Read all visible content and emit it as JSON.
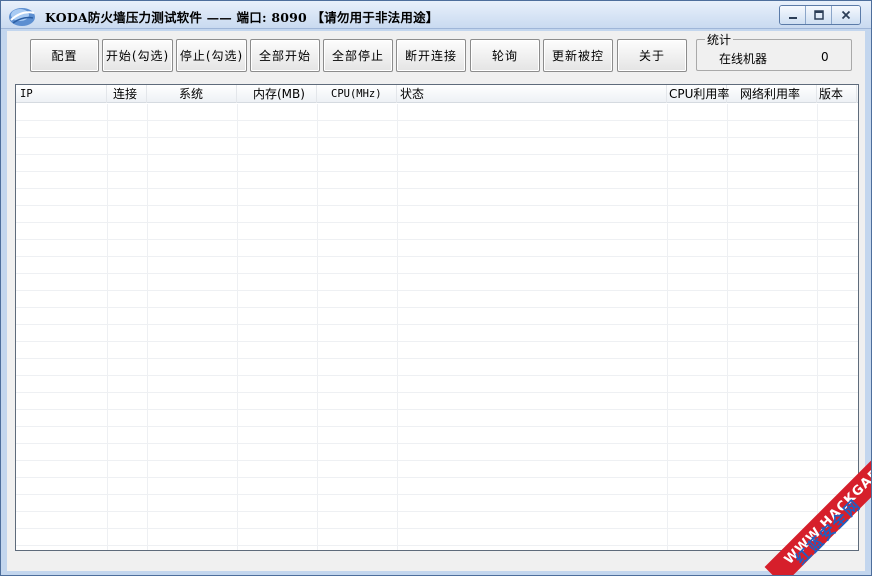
{
  "window": {
    "title": "KODA防火墙压力测试软件 —— 端口: 8090 【请勿用于非法用途】",
    "icon": "app-logo-icon",
    "controls": [
      "minimize-icon",
      "restore-icon",
      "close-icon"
    ]
  },
  "toolbar": {
    "buttons": [
      {
        "id": "config",
        "label": "配置"
      },
      {
        "id": "start_checked",
        "label": "开始(勾选)"
      },
      {
        "id": "stop_checked",
        "label": "停止(勾选)"
      },
      {
        "id": "start_all",
        "label": "全部开始"
      },
      {
        "id": "stop_all",
        "label": "全部停止"
      },
      {
        "id": "disconnect",
        "label": "断开连接"
      },
      {
        "id": "poll",
        "label": "轮询"
      },
      {
        "id": "update",
        "label": "更新被控"
      },
      {
        "id": "about",
        "label": "关于"
      }
    ]
  },
  "stats": {
    "legend": "统计",
    "online_label": "在线机器",
    "online_count": "0"
  },
  "list": {
    "columns": [
      "IP",
      "连接",
      "系统",
      "内存(MB)",
      "CPU(MHz)",
      "状态",
      "CPU利用率",
      "网络利用率",
      "版本"
    ],
    "rows": []
  },
  "watermark": {
    "url": "WWW.HACKGAB.COM",
    "site": "红蓝安全网"
  },
  "colors": {
    "titlebar": "#c9daf0",
    "client": "#f0f0f0",
    "watermark_red": "#d61f2b",
    "watermark_blue": "#1f5fc2"
  }
}
